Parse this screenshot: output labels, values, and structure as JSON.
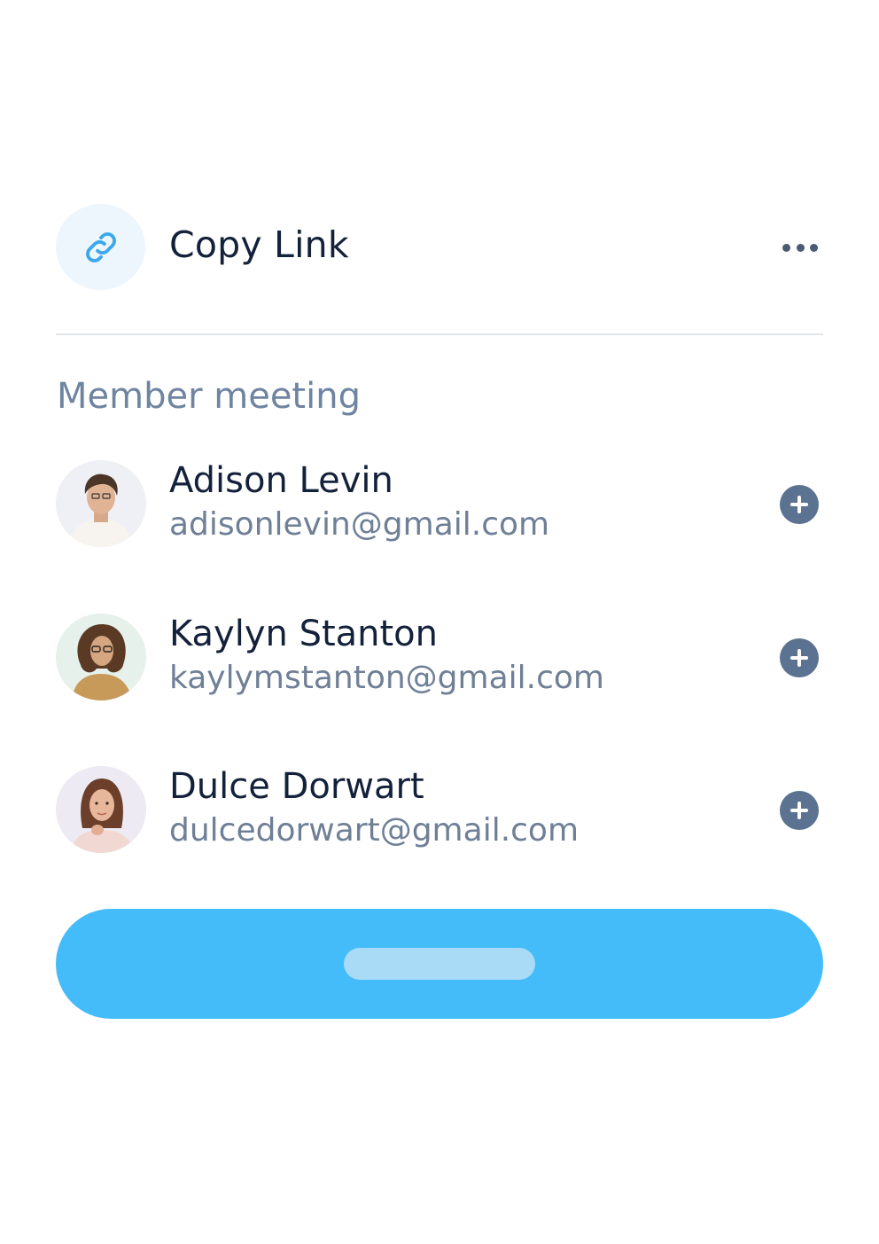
{
  "share": {
    "copy_link_label": "Copy Link",
    "link_icon": "link-icon",
    "more_icon": "more-horizontal-icon"
  },
  "members_section": {
    "title": "Member meeting",
    "members": [
      {
        "name": "Adison Levin",
        "email": "adisonlevin@gmail.com",
        "avatar": "avatar-photo"
      },
      {
        "name": "Kaylyn Stanton",
        "email": "kaylymstanton@gmail.com",
        "avatar": "avatar-photo"
      },
      {
        "name": "Dulce Dorwart",
        "email": "dulcedorwart@gmail.com",
        "avatar": "avatar-photo"
      }
    ],
    "add_icon": "plus-circle-icon"
  },
  "colors": {
    "primary_button": "#45bcfa",
    "title_text": "#14213a",
    "muted_text": "#6e84a0",
    "add_icon": "#5b7291"
  }
}
